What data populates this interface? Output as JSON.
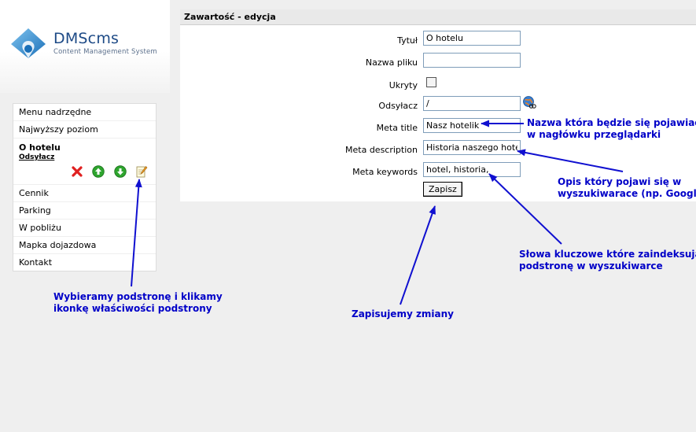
{
  "logo": {
    "name": "DMScms",
    "tagline": "Content Management System"
  },
  "menu": {
    "items_top": [
      "Menu nadrzędne",
      "Najwyższy poziom"
    ],
    "active": {
      "title": "O hotelu",
      "link": "Odsyłacz",
      "icons": [
        "delete-icon",
        "move-up-icon",
        "move-down-icon",
        "edit-properties-icon"
      ]
    },
    "items_bottom": [
      "Cennik",
      "Parking",
      "W pobliżu",
      "Mapka dojazdowa",
      "Kontakt"
    ]
  },
  "panel": {
    "header": "Zawartość - edycja",
    "fields": {
      "title": {
        "label": "Tytuł",
        "value": "O hotelu"
      },
      "filename": {
        "label": "Nazwa pliku",
        "value": ""
      },
      "hidden": {
        "label": "Ukryty",
        "checked": false
      },
      "redirect": {
        "label": "Odsyłacz",
        "value": "/"
      },
      "meta_title": {
        "label": "Meta title",
        "value": "Nasz hotelik"
      },
      "meta_description": {
        "label": "Meta description",
        "value": "Historia naszego hotelu"
      },
      "meta_keywords": {
        "label": "Meta keywords",
        "value": "hotel, historia,"
      }
    },
    "submit_label": "Zapisz"
  },
  "annotations": {
    "meta_title": [
      "Nazwa która będzie się pojawiać",
      "w nagłówku przeglądarki"
    ],
    "meta_description": [
      "Opis który pojawi się w",
      "wyszukiwarace (np. Google)"
    ],
    "meta_keywords": [
      "Słowa kluczowe które zaindeksują",
      "podstronę w wyszukiwarce"
    ],
    "submit": [
      "Zapisujemy zmiany"
    ],
    "menu": [
      "Wybieramy podstronę i klikamy",
      "ikonkę właściwości podstrony"
    ]
  },
  "colors": {
    "annotation": "#0000c8",
    "logo": "#1d4a86"
  }
}
